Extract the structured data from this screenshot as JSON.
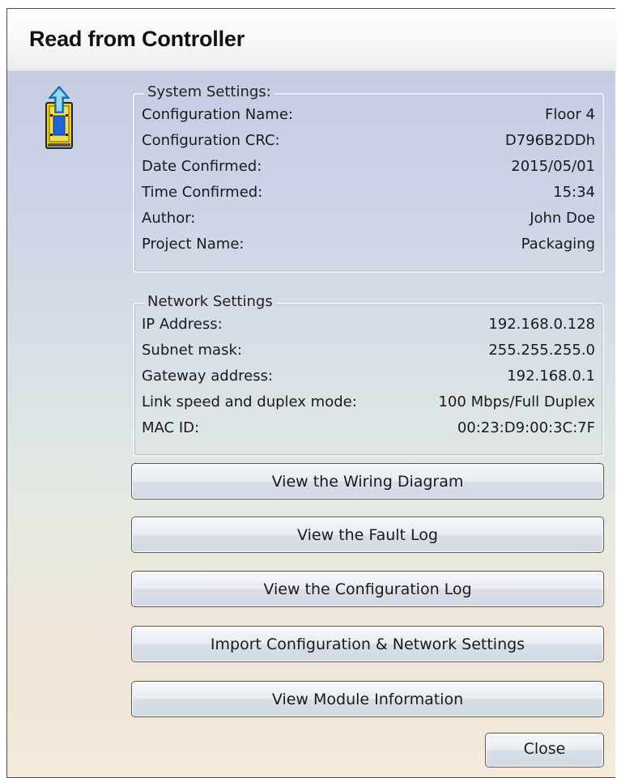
{
  "window": {
    "title": "Read from Controller"
  },
  "app_icon": "controller-upload-icon",
  "system_settings": {
    "legend": "System Settings:",
    "rows": [
      {
        "label": "Configuration Name:",
        "value": "Floor 4"
      },
      {
        "label": "Configuration CRC:",
        "value": "D796B2DDh"
      },
      {
        "label": "Date Confirmed:",
        "value": "2015/05/01"
      },
      {
        "label": "Time Confirmed:",
        "value": "15:34"
      },
      {
        "label": "Author:",
        "value": "John Doe"
      },
      {
        "label": "Project Name:",
        "value": "Packaging"
      }
    ]
  },
  "network_settings": {
    "legend": "Network Settings",
    "rows": [
      {
        "label": "IP Address:",
        "value": "192.168.0.128"
      },
      {
        "label": "Subnet mask:",
        "value": "255.255.255.0"
      },
      {
        "label": "Gateway address:",
        "value": "192.168.0.1"
      },
      {
        "label": "Link speed and duplex mode:",
        "value": "100 Mbps/Full Duplex"
      },
      {
        "label": "MAC ID:",
        "value": "00:23:D9:00:3C:7F"
      }
    ]
  },
  "buttons": {
    "wiring": "View the Wiring Diagram",
    "fault_log": "View the Fault Log",
    "config_log": "View the Configuration Log",
    "import": "Import Configuration & Network Settings",
    "module_info": "View Module Information",
    "close": "Close"
  },
  "colors": {
    "icon_yellow": "#f3d21a",
    "icon_blue": "#1f63d8",
    "icon_arrow": "#2aa1e8"
  }
}
